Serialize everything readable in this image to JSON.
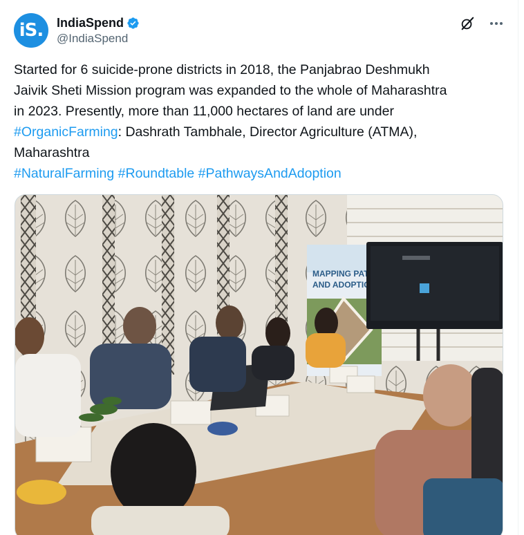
{
  "author": {
    "avatar_text": "iS.",
    "display_name": "IndiaSpend",
    "handle": "@IndiaSpend",
    "verified": true
  },
  "tweet": {
    "line1": "Started for 6 suicide-prone districts in 2018, the Panjabrao Deshmukh",
    "line2": "Jaivik Sheti Mission program was expanded to the whole of Maharashtra",
    "line3": "in 2023. Presently, more than 11,000 hectares of land are under",
    "hashtag1": "#OrganicFarming",
    "line4_rest": ": Dashrath Tambhale, Director Agriculture (ATMA),",
    "line5": "Maharashtra",
    "hashtag2": "#NaturalFarming",
    "hashtag3": "#Roundtable",
    "hashtag4": "#PathwaysAndAdoption"
  },
  "media": {
    "banner_line1": "MAPPING PATHWA",
    "banner_line2": "AND ADOPTION"
  },
  "icons": {
    "grok": "grok-icon",
    "more": "more-icon",
    "verified": "verified-badge-icon"
  },
  "colors": {
    "hashtag": "#1d9bf0",
    "avatar": "#1d8fe1",
    "verified": "#1d9bf0",
    "handle": "#536471"
  }
}
